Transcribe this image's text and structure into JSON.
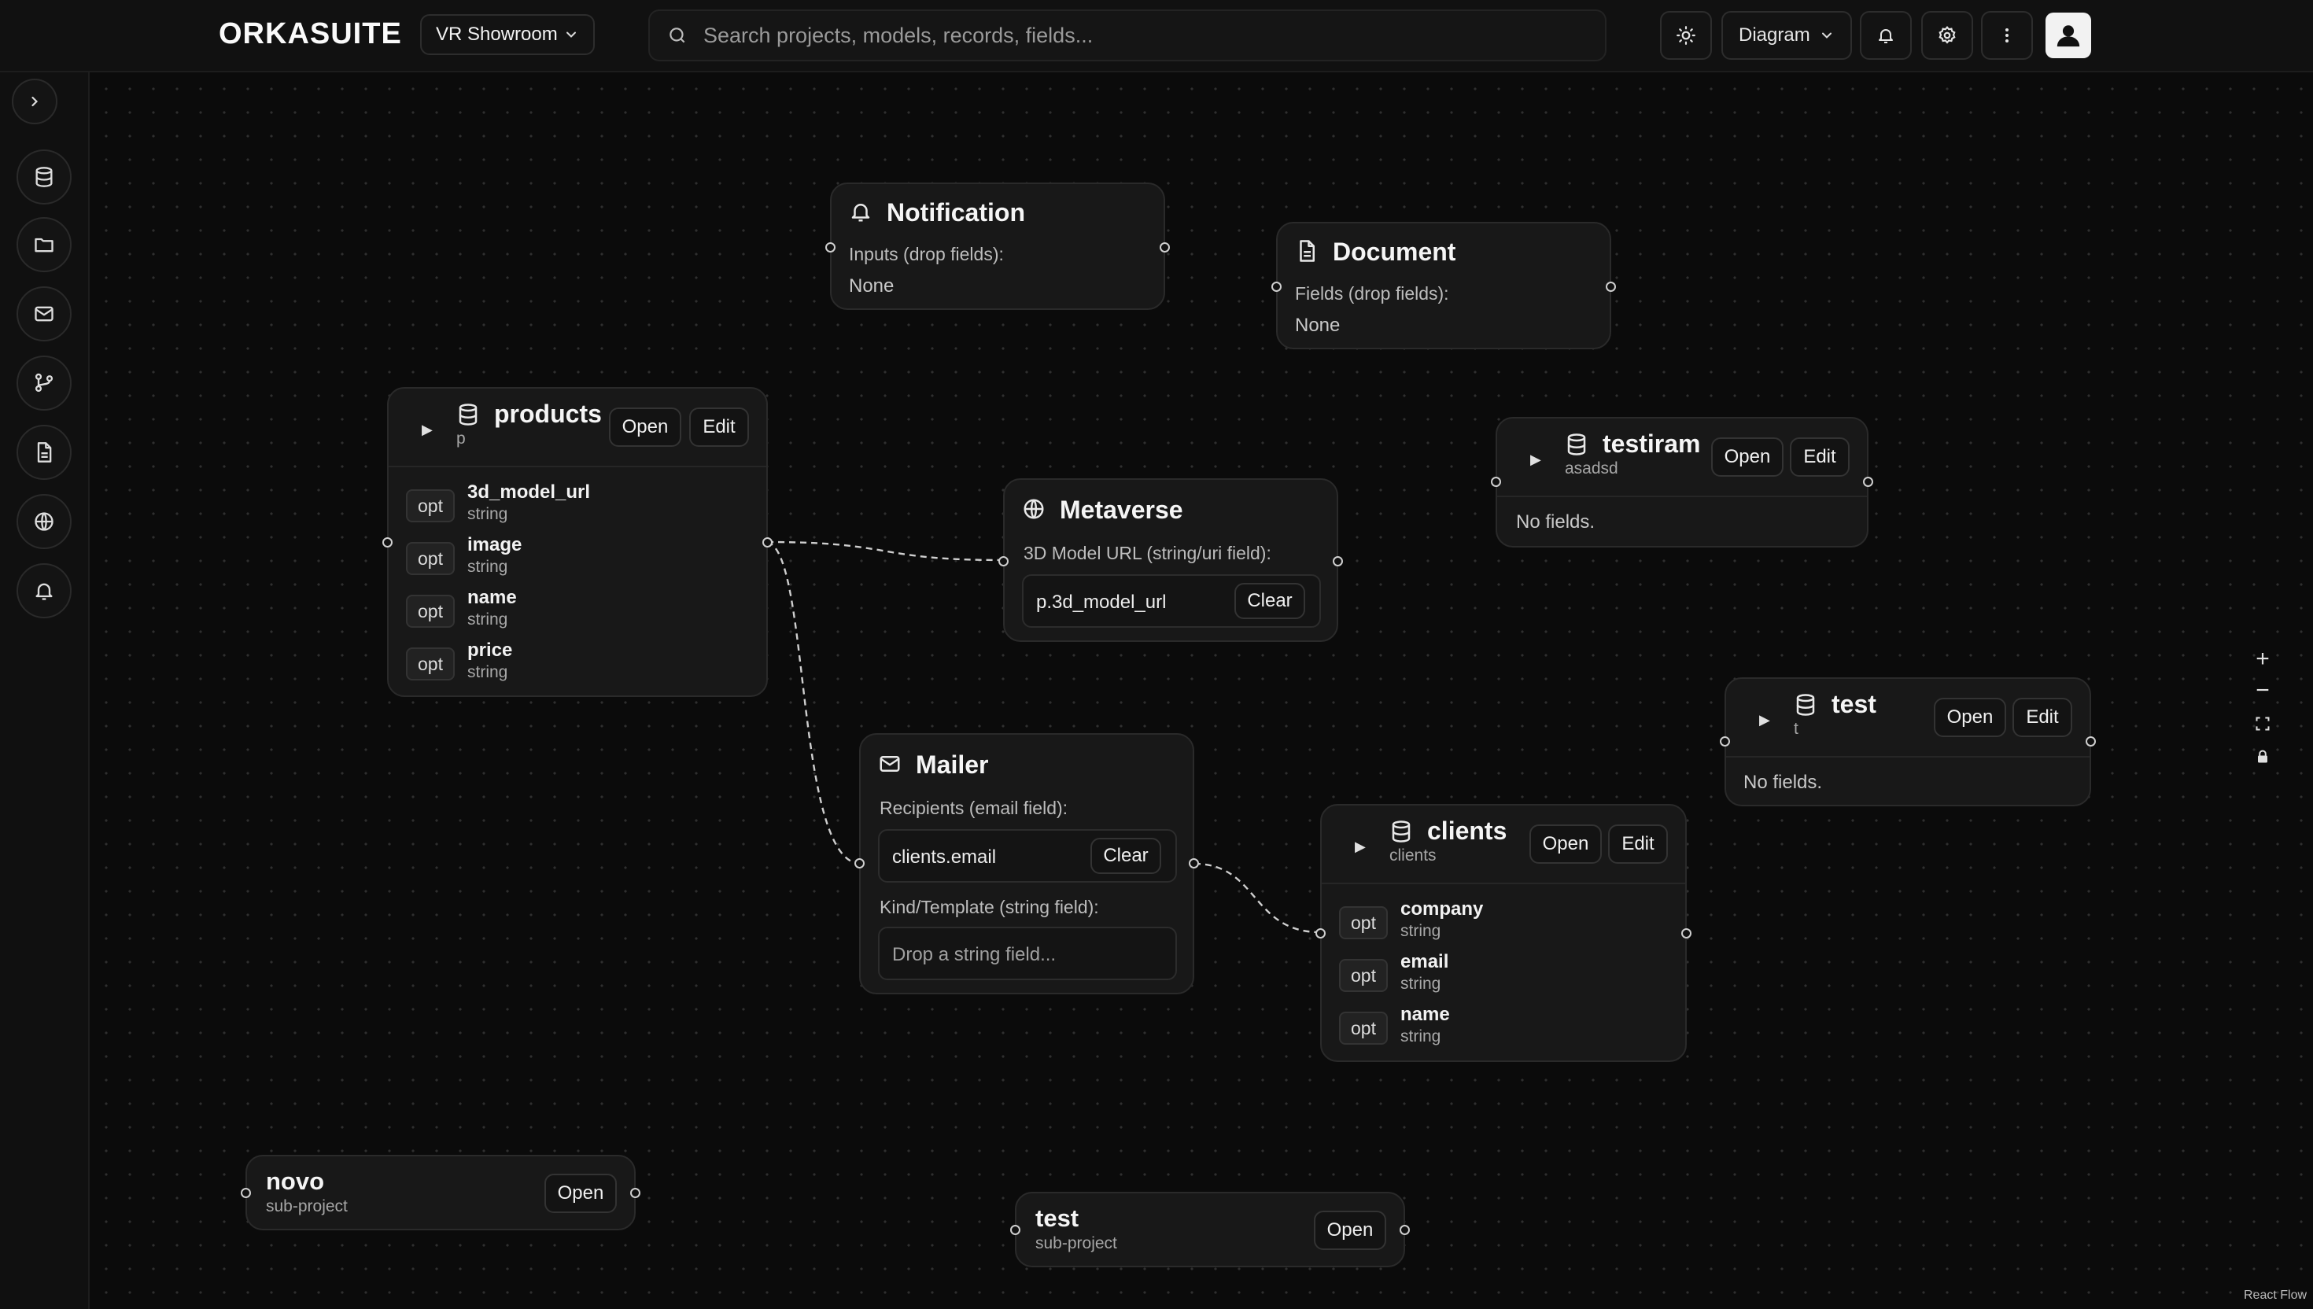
{
  "app": {
    "logo": "ORKASUITE"
  },
  "header": {
    "project_select": "VR Showroom",
    "search_placeholder": "Search projects, models, records, fields...",
    "view_select": "Diagram"
  },
  "colors": {
    "background": "#0b0b0b",
    "node": "#181818",
    "border": "#2a2a2a",
    "text": "#ededed",
    "muted": "#a6a6a6"
  },
  "sidebar": {
    "items": [
      {
        "icon": "chevron-right-icon"
      },
      {
        "icon": "database-icon"
      },
      {
        "icon": "folder-icon"
      },
      {
        "icon": "mail-icon"
      },
      {
        "icon": "git-branch-icon"
      },
      {
        "icon": "document-icon"
      },
      {
        "icon": "globe-icon"
      },
      {
        "icon": "bell-icon"
      }
    ]
  },
  "nodes": {
    "notification": {
      "title": "Notification",
      "label": "Inputs (drop fields):",
      "value": "None"
    },
    "document": {
      "title": "Document",
      "label": "Fields (drop fields):",
      "value": "None"
    },
    "products": {
      "title": "products",
      "subtitle": "p",
      "open": "Open",
      "edit": "Edit",
      "fields": [
        {
          "badge": "opt",
          "name": "3d_model_url",
          "type": "string"
        },
        {
          "badge": "opt",
          "name": "image",
          "type": "string"
        },
        {
          "badge": "opt",
          "name": "name",
          "type": "string"
        },
        {
          "badge": "opt",
          "name": "price",
          "type": "string"
        }
      ]
    },
    "metaverse": {
      "title": "Metaverse",
      "label": "3D Model URL (string/uri field):",
      "value": "p.3d_model_url",
      "clear": "Clear"
    },
    "testiram": {
      "title": "testiram",
      "subtitle": "asadsd",
      "open": "Open",
      "edit": "Edit",
      "empty": "No fields."
    },
    "test_model": {
      "title": "test",
      "subtitle": "t",
      "open": "Open",
      "edit": "Edit",
      "empty": "No fields."
    },
    "mailer": {
      "title": "Mailer",
      "recipients_label": "Recipients (email field):",
      "recipients_value": "clients.email",
      "clear": "Clear",
      "kind_label": "Kind/Template (string field):",
      "kind_placeholder": "Drop a string field..."
    },
    "clients": {
      "title": "clients",
      "subtitle": "clients",
      "open": "Open",
      "edit": "Edit",
      "fields": [
        {
          "badge": "opt",
          "name": "company",
          "type": "string"
        },
        {
          "badge": "opt",
          "name": "email",
          "type": "string"
        },
        {
          "badge": "opt",
          "name": "name",
          "type": "string"
        }
      ]
    },
    "novo": {
      "title": "novo",
      "subtitle": "sub-project",
      "open": "Open"
    },
    "test_sub": {
      "title": "test",
      "subtitle": "sub-project",
      "open": "Open"
    }
  },
  "controls": {
    "zoom_in": "+",
    "zoom_out": "−"
  },
  "attribution": "React Flow"
}
